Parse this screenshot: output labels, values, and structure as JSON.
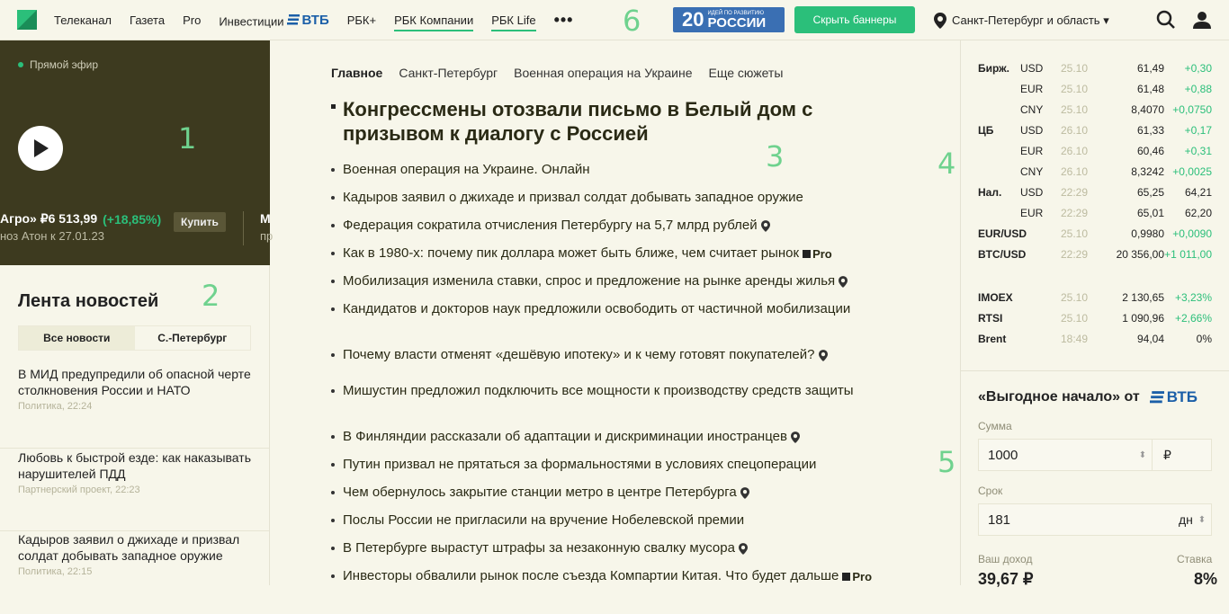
{
  "header": {
    "nav": [
      {
        "label": "Телеканал"
      },
      {
        "label": "Газета"
      },
      {
        "label": "Pro"
      },
      {
        "label": "Инвестиции"
      },
      {
        "label": "РБК+"
      },
      {
        "label": "РБК Компании"
      },
      {
        "label": "РБК Life"
      }
    ],
    "vtb_label": "ВТБ",
    "more_label": "•••",
    "badge": {
      "num": "20",
      "small": "ИДЕЙ ПО РАЗВИТИЮ",
      "big": "РОССИИ"
    },
    "hide_banners": "Скрыть баннеры",
    "region": "Санкт-Петербург и область ▾"
  },
  "annotations": [
    "1",
    "2",
    "3",
    "4",
    "5",
    "6"
  ],
  "live": {
    "label": "Прямой эфир",
    "ticker_name": "Агро» ₽6 513,99",
    "ticker_change": "(+18,85%)",
    "buy": "Купить",
    "ticker_sub": "ноз Атон к 27.01.23",
    "next": "М",
    "next_sub": "пр"
  },
  "feed": {
    "title": "Лента новостей",
    "tabs": [
      "Все новости",
      "С.-Петербург"
    ],
    "items": [
      {
        "title": "В МИД предупредили об опасной черте столкновения России и НАТО",
        "meta": "Политика, 22:24"
      },
      {
        "title": "Любовь к быстрой езде: как наказывать нарушителей ПДД",
        "meta": "Партнерский проект, 22:23"
      },
      {
        "title": "Кадыров заявил о джихаде и призвал солдат добывать западное оружие",
        "meta": "Политика, 22:15"
      }
    ]
  },
  "main": {
    "tabs": [
      "Главное",
      "Санкт-Петербург",
      "Военная операция на Украине",
      "Еще сюжеты"
    ],
    "headline": "Конгрессмены отозвали письмо в Белый дом с призывом к диалогу с Россией",
    "pro_label": "Pro",
    "news": [
      {
        "text": "Военная операция на Украине. Онлайн",
        "pin": false,
        "pro": false
      },
      {
        "text": "Кадыров заявил о джихаде и призвал солдат добывать западное оружие",
        "pin": false,
        "pro": false
      },
      {
        "text": "Федерация сократила отчисления Петербургу на 5,7 млрд рублей",
        "pin": true,
        "pro": false
      },
      {
        "text": "Как в 1980-х: почему пик доллара может быть ближе, чем считает рынок",
        "pin": false,
        "pro": true
      },
      {
        "text": "Мобилизация изменила ставки, спрос и предложение на рынке аренды жилья",
        "pin": true,
        "pro": false
      },
      {
        "text": "Кандидатов и докторов наук предложили освободить от частичной мобилизации",
        "pin": false,
        "pro": false
      },
      {
        "text": "Почему власти отменят «дешёвую ипотеку» и к чему готовят покупателей?",
        "pin": true,
        "pro": false
      },
      {
        "text": "Мишустин предложил подключить все мощности к производству средств защиты",
        "pin": false,
        "pro": false
      },
      {
        "text": "В Финляндии рассказали об адаптации и дискриминации иностранцев",
        "pin": true,
        "pro": false
      },
      {
        "text": "Путин призвал не прятаться за формальностями в условиях спецоперации",
        "pin": false,
        "pro": false
      },
      {
        "text": "Чем обернулось закрытие станции метро в центре Петербурга",
        "pin": true,
        "pro": false
      },
      {
        "text": "Послы России не пригласили на вручение Нобелевской премии",
        "pin": false,
        "pro": false
      },
      {
        "text": "В Петербурге вырастут штрафы за незаконную свалку мусора",
        "pin": true,
        "pro": false
      },
      {
        "text": "Инвесторы обвалили рынок после съезда Компартии Китая. Что будет дальше",
        "pin": false,
        "pro": true
      }
    ]
  },
  "quotes": [
    {
      "group": "Бирж.",
      "cur": "USD",
      "date": "25.10",
      "value": "61,49",
      "change": "+0,30",
      "green": true
    },
    {
      "group": "",
      "cur": "EUR",
      "date": "25.10",
      "value": "61,48",
      "change": "+0,88",
      "green": true
    },
    {
      "group": "",
      "cur": "CNY",
      "date": "25.10",
      "value": "8,4070",
      "change": "+0,0750",
      "green": true
    },
    {
      "group": "ЦБ",
      "cur": "USD",
      "date": "26.10",
      "value": "61,33",
      "change": "+0,17",
      "green": true
    },
    {
      "group": "",
      "cur": "EUR",
      "date": "26.10",
      "value": "60,46",
      "change": "+0,31",
      "green": true
    },
    {
      "group": "",
      "cur": "CNY",
      "date": "26.10",
      "value": "8,3242",
      "change": "+0,0025",
      "green": true
    },
    {
      "group": "Нал.",
      "cur": "USD",
      "date": "22:29",
      "value": "65,25",
      "change": "64,21",
      "green": false
    },
    {
      "group": "",
      "cur": "EUR",
      "date": "22:29",
      "value": "65,01",
      "change": "62,20",
      "green": false
    },
    {
      "group": "EUR/USD",
      "cur": "",
      "date": "25.10",
      "value": "0,9980",
      "change": "+0,0090",
      "green": true
    },
    {
      "group": "BTC/USD",
      "cur": "",
      "date": "22:29",
      "value": "20 356,00",
      "change": "+1 011,00",
      "green": true
    },
    {
      "group": "IMOEX",
      "cur": "",
      "date": "25.10",
      "value": "2 130,65",
      "change": "+3,23%",
      "green": true
    },
    {
      "group": "RTSI",
      "cur": "",
      "date": "25.10",
      "value": "1 090,96",
      "change": "+2,66%",
      "green": true
    },
    {
      "group": "Brent",
      "cur": "",
      "date": "18:49",
      "value": "94,04",
      "change": "0%",
      "green": false
    }
  ],
  "deposit": {
    "title": "«Выгодное начало» от",
    "vtb": "ВТБ",
    "sum_label": "Сумма",
    "sum_value": "1000",
    "sum_cur": "₽",
    "term_label": "Срок",
    "term_value": "181",
    "term_unit": "дн",
    "income_label": "Ваш доход",
    "income_value": "39,67 ₽",
    "rate_label": "Ставка",
    "rate_value": "8%"
  },
  "colors": {
    "accent": "#2bbf7a",
    "dark_panel": "#3d3a1f",
    "bg": "#f7f6ea",
    "vtb_blue": "#1b5fa8"
  }
}
